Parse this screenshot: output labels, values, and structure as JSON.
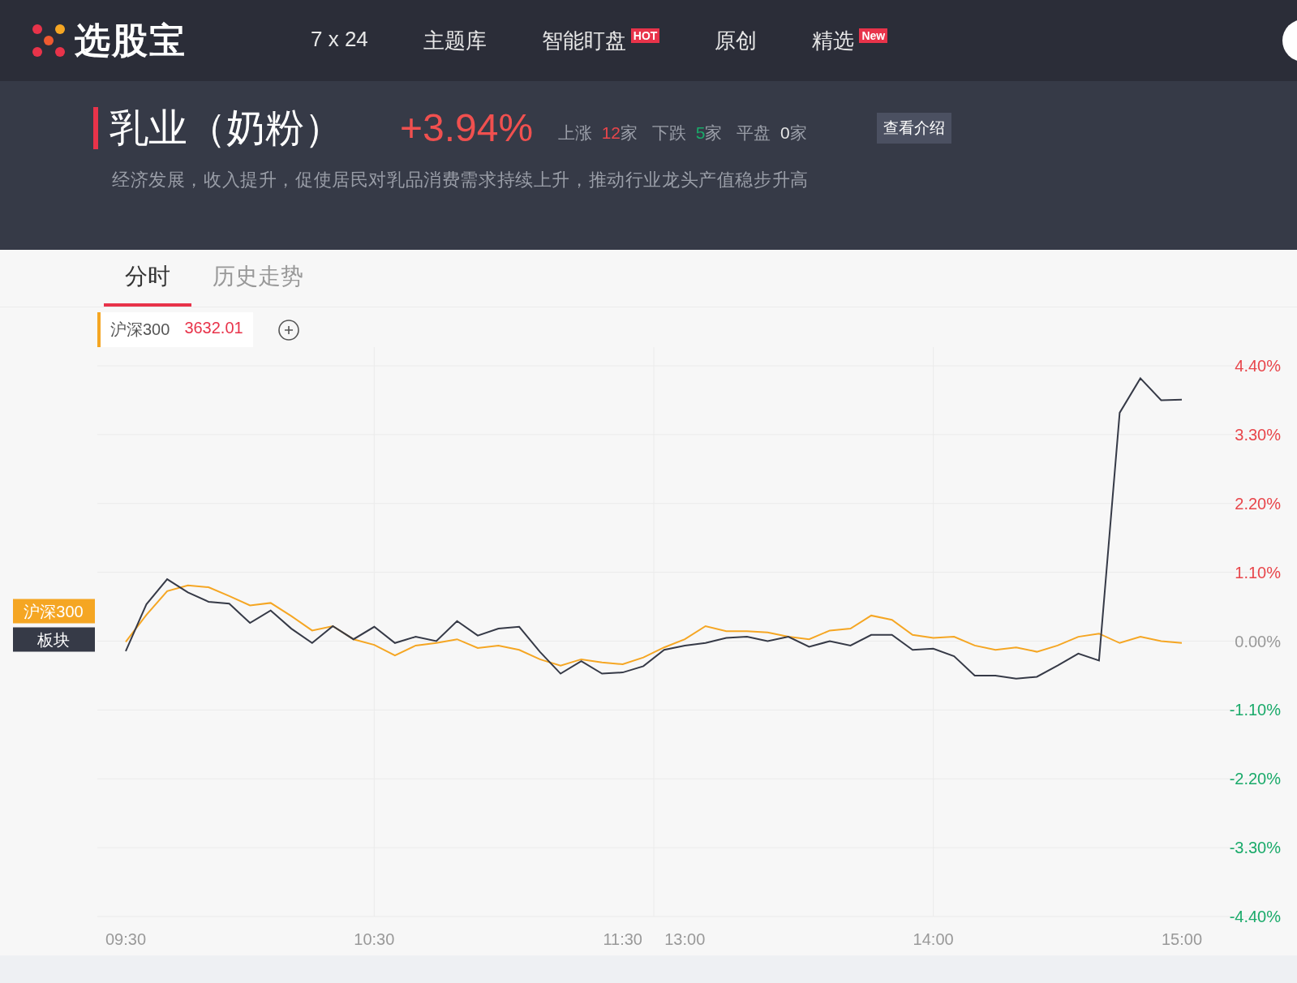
{
  "header": {
    "logo": "选股宝",
    "nav": [
      {
        "label": "7 x 24"
      },
      {
        "label": "主题库"
      },
      {
        "label": "智能盯盘",
        "badge": "HOT"
      },
      {
        "label": "原创"
      },
      {
        "label": "精选",
        "badge": "New"
      }
    ]
  },
  "sector": {
    "title": "乳业（奶粉）",
    "change": "+3.94%",
    "stats": [
      {
        "label": "上涨",
        "count": "12",
        "unit": "家",
        "kind": "up"
      },
      {
        "label": "下跌",
        "count": "5",
        "unit": "家",
        "kind": "down"
      },
      {
        "label": "平盘",
        "count": "0",
        "unit": "家",
        "kind": "flat"
      }
    ],
    "intro_button": "查看介绍",
    "description": "经济发展，收入提升，促使居民对乳品消费需求持续上升，推动行业龙头产值稳步升高"
  },
  "tabs": [
    {
      "label": "分时",
      "selected": true
    },
    {
      "label": "历史走势",
      "selected": false
    }
  ],
  "compare": {
    "name": "沪深300",
    "value": "3632.01"
  },
  "chart": {
    "chart_data": {
      "type": "line",
      "grid": true,
      "ylim": [
        -4.4,
        4.4
      ],
      "categories": [
        "09:30",
        null,
        null,
        null,
        null,
        null,
        null,
        null,
        null,
        null,
        null,
        null,
        "10:30",
        null,
        null,
        null,
        null,
        null,
        null,
        null,
        null,
        null,
        null,
        null,
        "11:30",
        null,
        null,
        "13:00",
        null,
        null,
        null,
        null,
        null,
        null,
        null,
        null,
        null,
        null,
        null,
        "14:00",
        null,
        null,
        null,
        null,
        null,
        null,
        null,
        null,
        null,
        null,
        null,
        "15:00"
      ],
      "yticks": [
        {
          "value": 4.4,
          "label": "4.40%"
        },
        {
          "value": 3.3,
          "label": "3.30%"
        },
        {
          "value": 2.2,
          "label": "2.20%"
        },
        {
          "value": 1.1,
          "label": "1.10%"
        },
        {
          "value": 0,
          "label": "0.00%"
        },
        {
          "value": -1.1,
          "label": "-1.10%"
        },
        {
          "value": -2.2,
          "label": "-2.20%"
        },
        {
          "value": -3.3,
          "label": "-3.30%"
        },
        {
          "value": -4.4,
          "label": "-4.40%"
        }
      ],
      "series": [
        {
          "name": "沪深300",
          "color": "#f5a623",
          "values": [
            -0.01,
            0.42,
            0.8,
            0.89,
            0.86,
            0.72,
            0.57,
            0.61,
            0.4,
            0.17,
            0.24,
            0.03,
            -0.06,
            -0.23,
            -0.07,
            -0.03,
            0.03,
            -0.11,
            -0.07,
            -0.14,
            -0.29,
            -0.39,
            -0.29,
            -0.34,
            -0.37,
            -0.26,
            -0.1,
            0.03,
            0.24,
            0.16,
            0.16,
            0.14,
            0.07,
            0.03,
            0.17,
            0.2,
            0.41,
            0.34,
            0.1,
            0.05,
            0.07,
            -0.07,
            -0.14,
            -0.1,
            -0.17,
            -0.07,
            0.07,
            0.12,
            -0.03,
            0.07,
            0,
            -0.03
          ]
        },
        {
          "name": "板块",
          "color": "#363a47",
          "values": [
            -0.16,
            0.59,
            0.99,
            0.78,
            0.63,
            0.6,
            0.29,
            0.49,
            0.2,
            -0.03,
            0.24,
            0.03,
            0.23,
            -0.03,
            0.07,
            0,
            0.32,
            0.09,
            0.2,
            0.23,
            -0.17,
            -0.52,
            -0.32,
            -0.52,
            -0.5,
            -0.4,
            -0.14,
            -0.07,
            -0.03,
            0.05,
            0.07,
            0,
            0.07,
            -0.09,
            0,
            -0.07,
            0.1,
            0.1,
            -0.14,
            -0.12,
            -0.24,
            -0.55,
            -0.55,
            -0.6,
            -0.57,
            -0.39,
            -0.2,
            -0.31,
            3.65,
            4.2,
            3.85,
            3.86
          ]
        }
      ]
    }
  }
}
